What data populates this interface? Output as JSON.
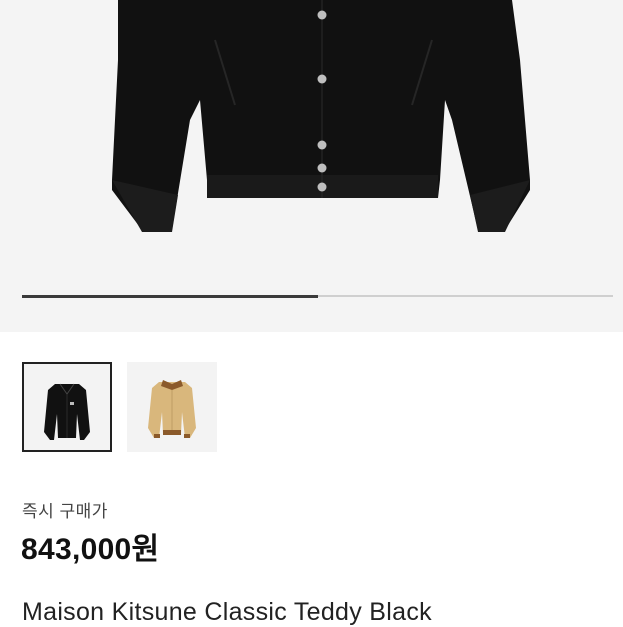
{
  "gallery": {
    "main_image": "black-teddy-jacket-image",
    "carousel_progress": 0.5,
    "thumbnails": [
      {
        "name": "black-jacket-thumbnail",
        "selected": true
      },
      {
        "name": "beige-jacket-thumbnail",
        "selected": false
      }
    ]
  },
  "purchase": {
    "label": "즉시 구매가",
    "price": "843,000원"
  },
  "product": {
    "title": "Maison Kitsune Classic Teddy Black"
  },
  "colors": {
    "jacket_black": "#111111",
    "jacket_beige": "#d9b77c",
    "accent_brown": "#8b5a2b",
    "progress_fill": "#3a3a3a"
  }
}
